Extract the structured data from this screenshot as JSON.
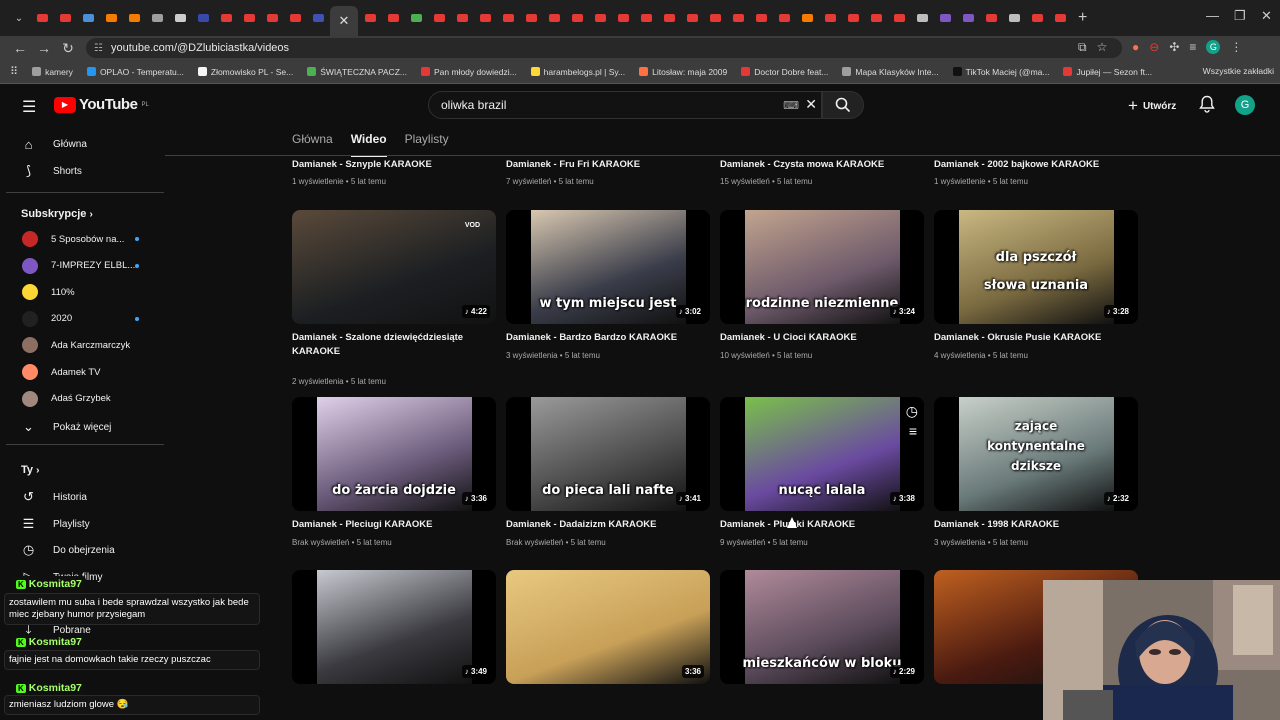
{
  "browser": {
    "url": "youtube.com/@DZlubiciastka/videos",
    "tab_colors": [
      "#e53935",
      "#e53935",
      "#4a90d9",
      "#f57c00",
      "#f57c00",
      "#9e9e9e",
      "#cccccc",
      "#3949ab",
      "#e53935",
      "#e53935",
      "#e53935",
      "#e53935",
      "#3f51b5",
      "#e53935",
      "#e53935",
      "#e53935",
      "#4caf50",
      "#e53935",
      "#e53935",
      "#e53935",
      "#e53935",
      "#e53935",
      "#e53935",
      "#e53935",
      "#e53935",
      "#e53935",
      "#e53935",
      "#e53935",
      "#e53935",
      "#e53935",
      "#e53935",
      "#e53935",
      "#e53935",
      "#f57c00",
      "#e53935",
      "#e53935",
      "#e53935",
      "#e53935",
      "#bdbdbd",
      "#7e57c2",
      "#7e57c2",
      "#e53935",
      "#bdbdbd",
      "#e53935",
      "#e53935"
    ],
    "active_tab_icon": "close-icon",
    "bookmarks": [
      {
        "label": "kamery",
        "color": "#9e9e9e"
      },
      {
        "label": "OPLAO - Temperatu...",
        "color": "#2196f3"
      },
      {
        "label": "Złomowisko PL - Se...",
        "color": "#f5f5f5"
      },
      {
        "label": "ŚWIĄTECZNA PACZ...",
        "color": "#4caf50"
      },
      {
        "label": "Pan młody dowiedzi...",
        "color": "#e53935"
      },
      {
        "label": "harambelogs.pl | Sy...",
        "color": "#fdd835"
      },
      {
        "label": "Litosław: maja 2009",
        "color": "#ff7043"
      },
      {
        "label": "Doctor Dobre feat...",
        "color": "#e53935"
      },
      {
        "label": "Mapa Klasyków Inte...",
        "color": "#9e9e9e"
      },
      {
        "label": "TikTok Maciej (@ma...",
        "color": "#111111"
      },
      {
        "label": "Jupiłej — Sezon ft...",
        "color": "#e53935"
      }
    ],
    "all_bookmarks": "Wszystkie zakładki"
  },
  "header": {
    "logo_text": "YouTube",
    "logo_region": "PL",
    "search_value": "oliwka brazil",
    "create_label": "Utwórz",
    "avatar_letter": "G"
  },
  "sidebar": {
    "home": "Główna",
    "shorts": "Shorts",
    "subs_header": "Subskrypcje",
    "subscriptions": [
      {
        "name": "5 Sposobów na...",
        "color": "#c62828",
        "new": true
      },
      {
        "name": "7-IMPREZY ELBL...",
        "color": "#7e57c2",
        "new": true
      },
      {
        "name": "110%",
        "color": "#fdd835",
        "new": false
      },
      {
        "name": "2020",
        "color": "#212121",
        "new": true
      },
      {
        "name": "Ada Karczmarczyk",
        "color": "#8d6e63",
        "new": false
      },
      {
        "name": "Adamek TV",
        "color": "#ff8a65",
        "new": false
      },
      {
        "name": "Adaś Grzybek",
        "color": "#a1887f",
        "new": false
      }
    ],
    "show_more": "Pokaż więcej",
    "you_header": "Ty",
    "history": "Historia",
    "playlists": "Playlisty",
    "watch_later": "Do obejrzenia",
    "your_videos": "Twoje filmy",
    "downloads": "Pobrane"
  },
  "channel_tabs": [
    "Główna",
    "Wideo",
    "Playlisty"
  ],
  "videos_top": [
    {
      "title": "Damianek - Sznyple KARAOKE",
      "meta": "1 wyświetlenie • 5 lat temu"
    },
    {
      "title": "Damianek - Fru Fri KARAOKE",
      "meta": "7 wyświetleń • 5 lat temu"
    },
    {
      "title": "Damianek - Czysta mowa KARAOKE",
      "meta": "15 wyświetleń • 5 lat temu"
    },
    {
      "title": "Damianek - 2002 bajkowe KARAOKE",
      "meta": "1 wyświetlenie • 5 lat temu"
    }
  ],
  "videos_row1": [
    {
      "title": "Damianek - Szalone dziewięćdziesiąte KARAOKE",
      "meta": "2 wyświetlenia • 5 lat temu",
      "duration": "♪ 4:22",
      "overlay": "",
      "bg": "#1c1f22",
      "c2": "#5a4a3a"
    },
    {
      "title": "Damianek - Bardzo Bardzo KARAOKE",
      "meta": "3 wyświetlenia • 5 lat temu",
      "duration": "♪ 3:02",
      "overlay": "w tym miejscu jest",
      "bg": "#3a3d4a",
      "c2": "#d8c7b0"
    },
    {
      "title": "Damianek - U Cioci KARAOKE",
      "meta": "10 wyświetleń • 5 lat temu",
      "duration": "♪ 3:24",
      "overlay": "rodzinne niezmienne",
      "bg": "#6e5a6b",
      "c2": "#c2a48e"
    },
    {
      "title": "Damianek - Okrusie Pusie KARAOKE",
      "meta": "4 wyświetlenia • 5 lat temu",
      "duration": "♪ 3:28",
      "overlay": "dla pszczół / słowa uznania",
      "bg": "#7a6a40",
      "c2": "#c9b882"
    }
  ],
  "videos_row2": [
    {
      "title": "Damianek - Pleciugi KARAOKE",
      "meta": "Brak wyświetleń • 5 lat temu",
      "duration": "♪ 3:36",
      "overlay": "do żarcia dojdzie",
      "bg": "#6a5a7a",
      "c2": "#e0d0e8"
    },
    {
      "title": "Damianek - Dadaizizm KARAOKE",
      "meta": "Brak wyświetleń • 5 lat temu",
      "duration": "♪ 3:41",
      "overlay": "do pieca lali nafte",
      "bg": "#4a4a4a",
      "c2": "#9a9a9a"
    },
    {
      "title": "Damianek - Plumki KARAOKE",
      "meta": "9 wyświetleń • 5 lat temu",
      "duration": "♪ 3:38",
      "overlay": "nucąc lalala",
      "bg": "#6a4aa0",
      "c2": "#7ac04a"
    },
    {
      "title": "Damianek - 1998 KARAOKE",
      "meta": "3 wyświetlenia • 5 lat temu",
      "duration": "♪ 2:32",
      "overlay": "zające / kontynentalne / dziksze",
      "bg": "#6a7a7a",
      "c2": "#c8d0c8"
    }
  ],
  "videos_row3": [
    {
      "duration": "♪ 3:49",
      "overlay": "",
      "bg": "#3a3a40",
      "c2": "#c8c8d0"
    },
    {
      "duration": "3:36",
      "overlay": "",
      "bg": "#c8a058",
      "c2": "#e8c880"
    },
    {
      "duration": "♪ 2:29",
      "overlay": "mieszkańców w bloku",
      "bg": "#5a4a5a",
      "c2": "#b08a9a"
    },
    {
      "duration": "",
      "overlay": "",
      "bg": "#4a1a10",
      "c2": "#c06020"
    }
  ],
  "chat": {
    "user": "Kosmita97",
    "messages": [
      "zostawilem mu suba i bede sprawdzal wszystko jak bede miec zjebany humor przysiegam",
      "fajnie jest na domowkach takie rzeczy puszczac",
      "zmieniasz ludziom glowe 😪"
    ]
  }
}
